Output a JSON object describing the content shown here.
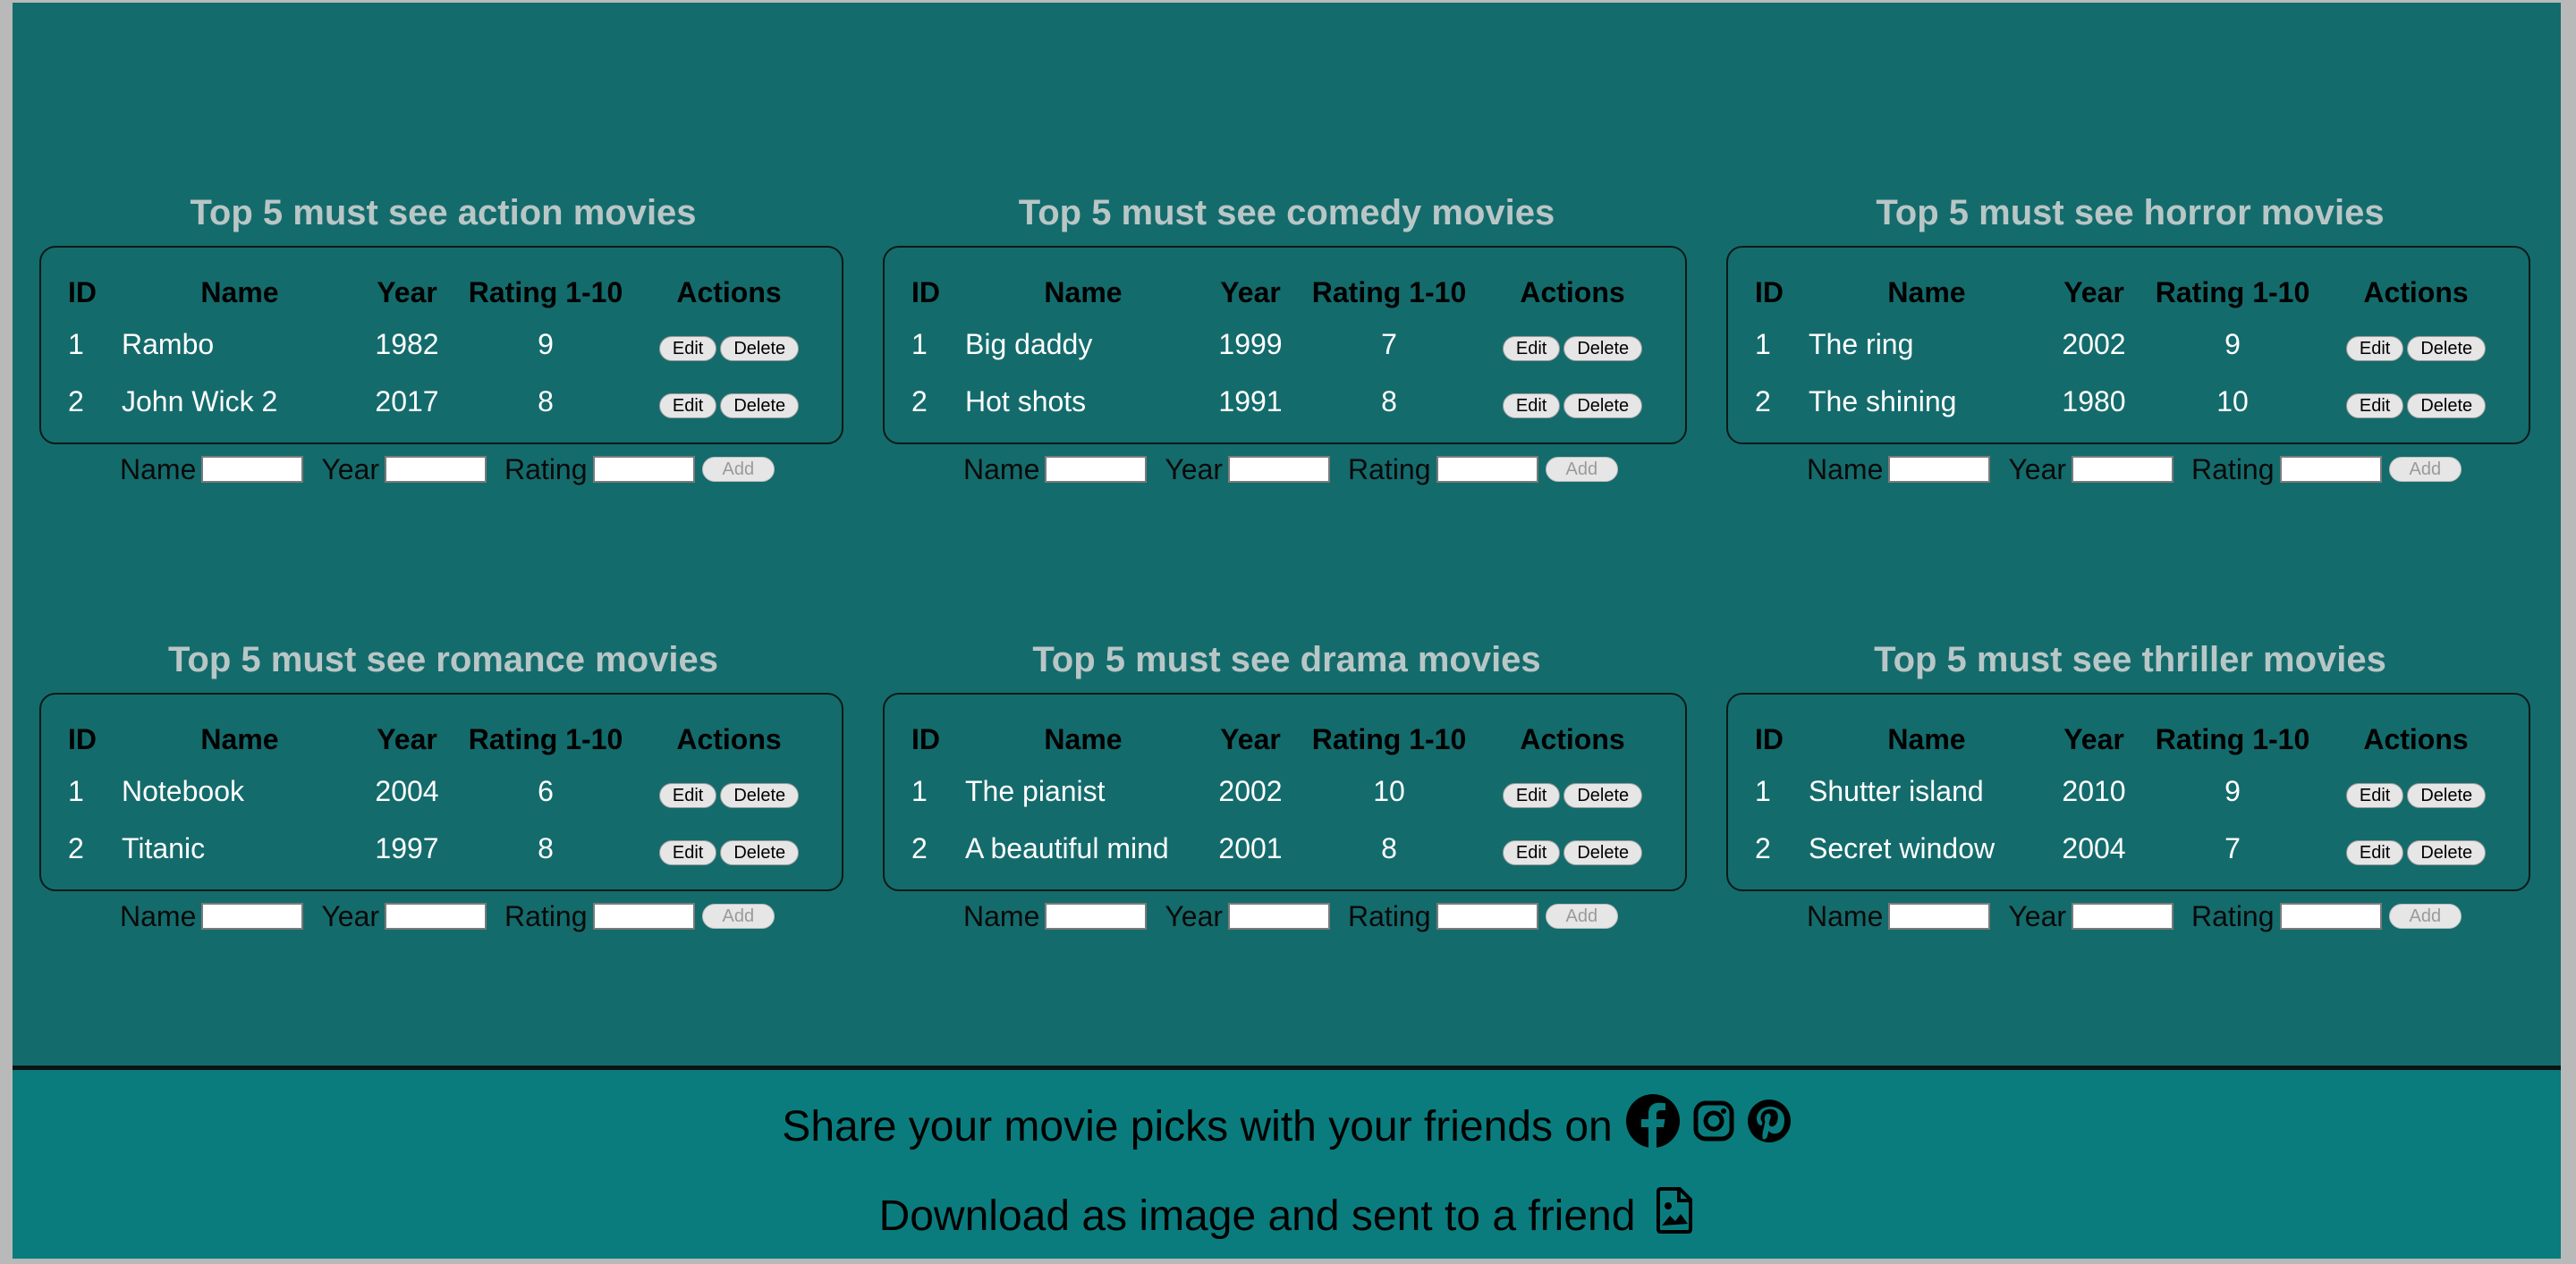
{
  "sections": [
    {
      "title": "Top 5 must see action movies",
      "movies": [
        {
          "id": "1",
          "name": "Rambo",
          "year": "1982",
          "rating": "9"
        },
        {
          "id": "2",
          "name": "John Wick 2",
          "year": "2017",
          "rating": "8"
        }
      ]
    },
    {
      "title": "Top 5 must see comedy movies",
      "movies": [
        {
          "id": "1",
          "name": "Big daddy",
          "year": "1999",
          "rating": "7"
        },
        {
          "id": "2",
          "name": "Hot shots",
          "year": "1991",
          "rating": "8"
        }
      ]
    },
    {
      "title": "Top 5 must see horror movies",
      "movies": [
        {
          "id": "1",
          "name": "The ring",
          "year": "2002",
          "rating": "9"
        },
        {
          "id": "2",
          "name": "The shining",
          "year": "1980",
          "rating": "10"
        }
      ]
    },
    {
      "title": "Top 5 must see romance movies",
      "movies": [
        {
          "id": "1",
          "name": "Notebook",
          "year": "2004",
          "rating": "6"
        },
        {
          "id": "2",
          "name": "Titanic",
          "year": "1997",
          "rating": "8"
        }
      ]
    },
    {
      "title": "Top 5 must see drama movies",
      "movies": [
        {
          "id": "1",
          "name": "The pianist",
          "year": "2002",
          "rating": "10"
        },
        {
          "id": "2",
          "name": "A beautiful mind",
          "year": "2001",
          "rating": "8"
        }
      ]
    },
    {
      "title": "Top 5 must see thriller movies",
      "movies": [
        {
          "id": "1",
          "name": "Shutter island",
          "year": "2010",
          "rating": "9"
        },
        {
          "id": "2",
          "name": "Secret window",
          "year": "2004",
          "rating": "7"
        }
      ]
    }
  ],
  "columns": {
    "id": "ID",
    "name": "Name",
    "year": "Year",
    "rating": "Rating 1-10",
    "actions": "Actions"
  },
  "buttons": {
    "edit": "Edit",
    "delete": "Delete",
    "add": "Add"
  },
  "form": {
    "name_label": "Name",
    "year_label": "Year",
    "rating_label": "Rating"
  },
  "footer": {
    "share_text": "Share your movie picks with your friends on",
    "share_icons": [
      "facebook-icon",
      "instagram-icon",
      "pinterest-icon"
    ],
    "download_text": "Download as image and sent to a friend",
    "download_icon": "image-download-icon"
  },
  "colors": {
    "background": "#146b6c",
    "footer": "#0a7c7e",
    "title": "#b9c6c6"
  }
}
